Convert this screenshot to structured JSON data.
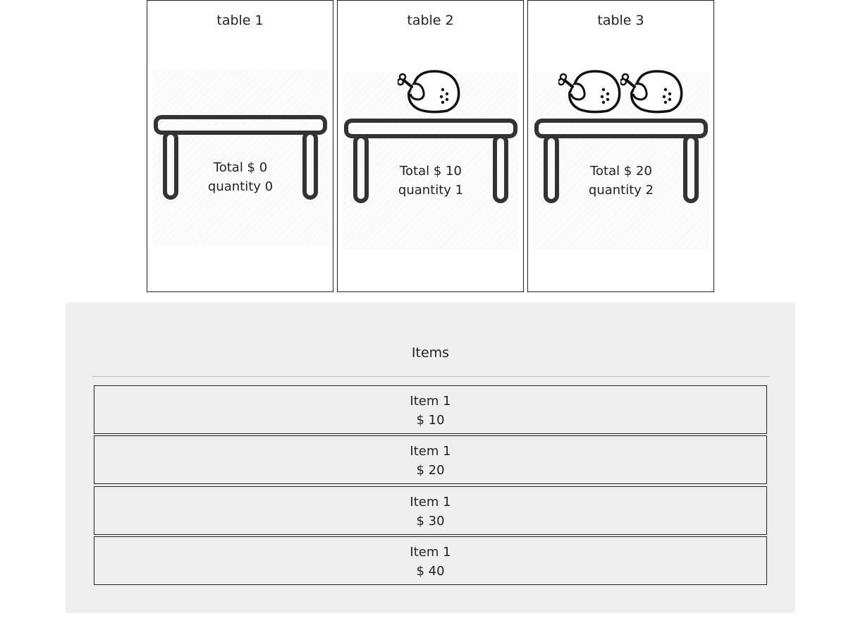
{
  "tables": [
    {
      "title": "table 1",
      "total_text": "Total $ 0",
      "quantity_text": "quantity 0",
      "icon_count": 0
    },
    {
      "title": "table 2",
      "total_text": "Total $ 10",
      "quantity_text": "quantity 1",
      "icon_count": 1
    },
    {
      "title": "table 3",
      "total_text": "Total $ 20",
      "quantity_text": "quantity 2",
      "icon_count": 2
    }
  ],
  "items_panel": {
    "heading": "Items",
    "items": [
      {
        "name": "Item 1",
        "price": "$ 10"
      },
      {
        "name": "Item 1",
        "price": "$ 20"
      },
      {
        "name": "Item 1",
        "price": "$ 30"
      },
      {
        "name": "Item 1",
        "price": "$ 40"
      }
    ]
  },
  "icons": {
    "table": "table-icon",
    "food": "roast-chicken-icon"
  },
  "colors": {
    "panel_bg": "#efefef",
    "line": "#333333"
  }
}
